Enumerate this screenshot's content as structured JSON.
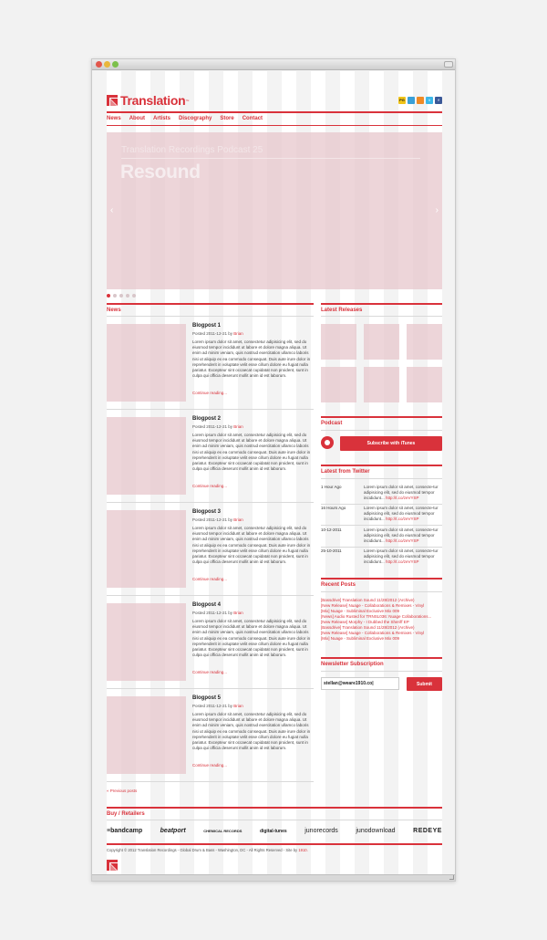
{
  "brand": {
    "name": "Translation",
    "trademark": "™",
    "color": "#d9323b"
  },
  "social": [
    {
      "icon": "rss-icon",
      "label": "PG",
      "color": "#f0c419"
    },
    {
      "icon": "soundcloud-icon",
      "label": "",
      "color": "#3aa0d8"
    },
    {
      "icon": "rss-feed-icon",
      "label": "",
      "color": "#f08a24"
    },
    {
      "icon": "twitter-icon",
      "label": "t",
      "color": "#3cb8e8"
    },
    {
      "icon": "facebook-icon",
      "label": "f",
      "color": "#3b5998"
    }
  ],
  "nav": [
    "News",
    "About",
    "Artists",
    "Discography",
    "Store",
    "Contact"
  ],
  "hero": {
    "subtitle": "Translation Recordings Podcast 25",
    "title": "Resound",
    "prev_arrow": "‹",
    "next_arrow": "›"
  },
  "news": {
    "title": "News",
    "posts": [
      {
        "title": "Blogpost 1",
        "posted": "Posted 2011-12-21 by",
        "author": "Brian",
        "body": "Lorem ipsum dolor sit amet, consectetur adipisicing elit, sed do eiusmod tempor incididunt ut labore et dolore magna aliqua. Ut enim ad minim veniam, quis nostrud exercitation ullamco laboris nisi ut aliquip ex ea commodo consequat. Duis aute irure dolor in reprehenderit in voluptate velit esse cillum dolore eu fugiat nulla pariatur. Excepteur sint occaecat cupidatat non proident, sunt in culpa qui officia deserunt mollit anim id est laborum.",
        "more": "Continue reading..."
      },
      {
        "title": "Blogpost 2",
        "posted": "Posted 2011-12-21 by",
        "author": "Brian",
        "body": "Lorem ipsum dolor sit amet, consectetur adipisicing elit, sed do eiusmod tempor incididunt ut labore et dolore magna aliqua. Ut enim ad minim veniam, quis nostrud exercitation ullamco laboris nisi ut aliquip ex ea commodo consequat. Duis aute irure dolor in reprehenderit in voluptate velit esse cillum dolore eu fugiat nulla pariatur. Excepteur sint occaecat cupidatat non proident, sunt in culpa qui officia deserunt mollit anim id est laborum.",
        "more": "Continue reading..."
      },
      {
        "title": "Blogpost 3",
        "posted": "Posted 2011-12-21 by",
        "author": "Brian",
        "body": "Lorem ipsum dolor sit amet, consectetur adipisicing elit, sed do eiusmod tempor incididunt ut labore et dolore magna aliqua. Ut enim ad minim veniam, quis nostrud exercitation ullamco laboris nisi ut aliquip ex ea commodo consequat. Duis aute irure dolor in reprehenderit in voluptate velit esse cillum dolore eu fugiat nulla pariatur. Excepteur sint occaecat cupidatat non proident, sunt in culpa qui officia deserunt mollit anim id est laborum.",
        "more": "Continue reading..."
      },
      {
        "title": "Blogpost 4",
        "posted": "Posted 2011-12-21 by",
        "author": "Brian",
        "body": "Lorem ipsum dolor sit amet, consectetur adipisicing elit, sed do eiusmod tempor incididunt ut labore et dolore magna aliqua. Ut enim ad minim veniam, quis nostrud exercitation ullamco laboris nisi ut aliquip ex ea commodo consequat. Duis aute irure dolor in reprehenderit in voluptate velit esse cillum dolore eu fugiat nulla pariatur. Excepteur sint occaecat cupidatat non proident, sunt in culpa qui officia deserunt mollit anim id est laborum.",
        "more": "Continue reading..."
      },
      {
        "title": "Blogpost 5",
        "posted": "Posted 2011-12-21 by",
        "author": "Brian",
        "body": "Lorem ipsum dolor sit amet, consectetur adipisicing elit, sed do eiusmod tempor incididunt ut labore et dolore magna aliqua. Ut enim ad minim veniam, quis nostrud exercitation ullamco laboris nisi ut aliquip ex ea commodo consequat. Duis aute irure dolor in reprehenderit in voluptate velit esse cillum dolore eu fugiat nulla pariatur. Excepteur sint occaecat cupidatat non proident, sunt in culpa qui officia deserunt mollit anim id est laborum.",
        "more": "Continue reading..."
      }
    ],
    "previous": "« Previous posts"
  },
  "sidebar": {
    "releases_title": "Latest Releases",
    "podcast_title": "Podcast",
    "podcast_button": "Subscribe with iTunes",
    "twitter_title": "Latest from Twitter",
    "tweets": [
      {
        "time": "1 Hour Ago",
        "text": "Lorem ipsum dolor sit amet, consecte-tur adipisicing elit, sed do eiusmod tempor incididunt...",
        "link": "http://t.co/zeVYSP"
      },
      {
        "time": "16 Hours Ago",
        "text": "Lorem ipsum dolor sit amet, consecte-tur adipisicing elit, sed do eiusmod tempor incididunt...",
        "link": "http://t.co/zeVYSP"
      },
      {
        "time": "10-12-2011",
        "text": "Lorem ipsum dolor sit amet, consecte-tur adipisicing elit, sed do eiusmod tempor incididunt...",
        "link": "http://t.co/zeVYSP"
      },
      {
        "time": "25-10-2011",
        "text": "Lorem ipsum dolor sit amet, consecte-tur adipisicing elit, sed do eiusmod tempor incididunt...",
        "link": "http://t.co/zeVYSP"
      }
    ],
    "recent_title": "Recent Posts",
    "recent_posts": [
      "[Bassdrive] Translation Sound 11/28/2012 (Archive)",
      "[New Release] Nuage - Collaborations & Remixes - Vinyl",
      "[Mix] Nuage - Subliminal Exclusive Mix 009",
      "[News] Audio Rusted for TRNSL036: Nuage Collaborations...",
      "[New Release] Morphy - I Dubbed the Sheriff EP",
      "[Bassdrive] Translation Sound 11/28/2012 (Archive)",
      "[New Release] Nuage - Collaborations & Remixes - Vinyl",
      "[Mix] Nuage - Subliminal Exclusive Mix 009"
    ],
    "newsletter_title": "Newsletter Subscription",
    "newsletter_value": "stellan@weare1910.co|",
    "newsletter_button": "Submit"
  },
  "footer": {
    "retailers_title": "Buy / Retailers",
    "retailers": [
      "≡bandcamp",
      "beatport",
      "CHEMICAL RECORDS",
      "digital-tunes",
      "junorecords",
      "junodownload",
      "REDEYE"
    ],
    "copyright": "Copyright © 2012 Translation Recordings - Global Drum & Bass - Washington, DC - All Rights Reserved - Site by",
    "site_by": "1910."
  }
}
